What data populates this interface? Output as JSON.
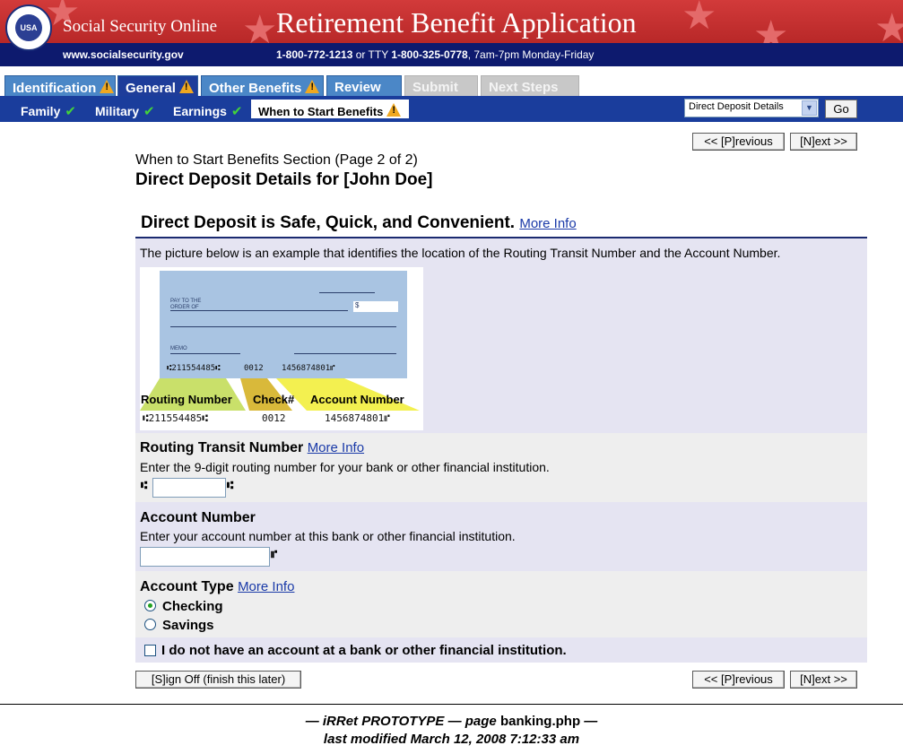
{
  "header": {
    "seal_text": "USA",
    "site_name": "Social Security Online",
    "app_title": "Retirement Benefit Application",
    "site_url": "www.socialsecurity.gov",
    "phone_main": "1-800-772-1213",
    "phone_or_tty": " or TTY ",
    "phone_tty": "1-800-325-0778",
    "phone_hours": ", 7am-7pm Monday-Friday"
  },
  "tabs": [
    {
      "label": "Identification",
      "state": "warning"
    },
    {
      "label": "General",
      "state": "active-warning"
    },
    {
      "label": "Other Benefits",
      "state": "warning"
    },
    {
      "label": "Review",
      "state": "normal"
    },
    {
      "label": "Submit",
      "state": "disabled"
    },
    {
      "label": "Next Steps",
      "state": "disabled"
    }
  ],
  "subnav": {
    "items": [
      {
        "label": "Family",
        "done": true
      },
      {
        "label": "Military",
        "done": true
      },
      {
        "label": "Earnings",
        "done": true
      }
    ],
    "active": "When to Start Benefits",
    "select_value": "Direct Deposit Details",
    "go_label": "Go"
  },
  "nav": {
    "previous": "<< [P]revious",
    "next": "[N]ext >>"
  },
  "page": {
    "subtitle": "When to Start Benefits Section (Page 2 of 2)",
    "title": "Direct Deposit Details for [John Doe]",
    "panel_heading": "Direct Deposit is Safe, Quick, and Convenient.",
    "more_info": "More Info",
    "intro": "The picture below is an example that identifies the location of the Routing Transit Number and the Account Number."
  },
  "check_image": {
    "pay_to": "PAY TO THE",
    "order_of": "ORDER OF",
    "dollar": "$",
    "memo": "MEMO",
    "micr_routing": "⑆211554485⑆",
    "micr_check": "0012",
    "micr_account": "1456874801⑈",
    "label_routing": "Routing Number",
    "label_check": "Check#",
    "label_account": "Account Number"
  },
  "routing": {
    "title": "Routing Transit Number",
    "description": "Enter the 9-digit routing number for your bank or other financial institution.",
    "value": "",
    "symbol": "⑆"
  },
  "account": {
    "title": "Account Number",
    "description": "Enter your account number at this bank or other financial institution.",
    "value": "",
    "symbol": "⑈"
  },
  "account_type": {
    "title": "Account Type",
    "options": [
      {
        "label": "Checking",
        "selected": true
      },
      {
        "label": "Savings",
        "selected": false
      }
    ]
  },
  "no_account": {
    "label": "I do not have an account at a bank or other financial institution.",
    "checked": false
  },
  "sign_off": "[S]ign Off (finish this later)",
  "footer": {
    "line1_a": "— iRRet PROTOTYPE — page ",
    "line1_b": "banking.php",
    "line1_c": " —",
    "line2": "last modified March 12, 2008 7:12:33 am"
  },
  "colors": {
    "banner_red": "#c43030",
    "navy": "#0d1a6e",
    "tab_blue": "#4b87c7",
    "subnav_blue": "#1a3d9c",
    "panel_lavender": "#e5e4f2",
    "panel_gray": "#eeeeee",
    "warning": "#f0a820",
    "check_green": "#43d23a"
  }
}
